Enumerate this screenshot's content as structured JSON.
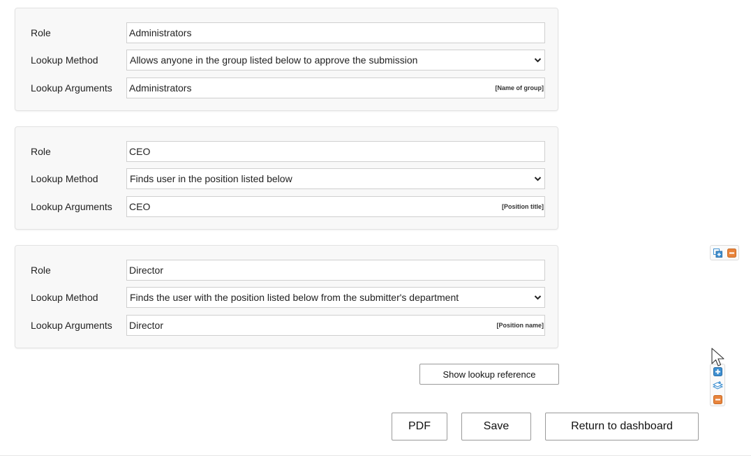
{
  "labels": {
    "role": "Role",
    "lookup_method": "Lookup Method",
    "lookup_arguments": "Lookup Arguments"
  },
  "approvers": [
    {
      "role": "Administrators",
      "lookup_method": "Allows anyone in the group listed below to approve the submission",
      "lookup_arguments": "Administrators",
      "hint": "[Name of group]"
    },
    {
      "role": "CEO",
      "lookup_method": "Finds user in the position listed below",
      "lookup_arguments": "CEO",
      "hint": "[Position title]"
    },
    {
      "role": "Director",
      "lookup_method": "Finds the user with the position listed below from the submitter's department",
      "lookup_arguments": "Director",
      "hint": "[Position name]"
    }
  ],
  "buttons": {
    "show_lookup_reference": "Show lookup reference",
    "pdf": "PDF",
    "save": "Save",
    "return_to_dashboard": "Return to dashboard"
  },
  "icons": {
    "duplicate": "duplicate-icon",
    "remove": "remove-icon",
    "add": "add-icon",
    "sort": "sort-layers-icon",
    "cursor": "mouse-pointer-icon"
  },
  "colors": {
    "accent_blue": "#3d8fd1",
    "remove_orange": "#e8843c",
    "card_bg": "#f8f8f8",
    "border": "#cfcfcf"
  }
}
